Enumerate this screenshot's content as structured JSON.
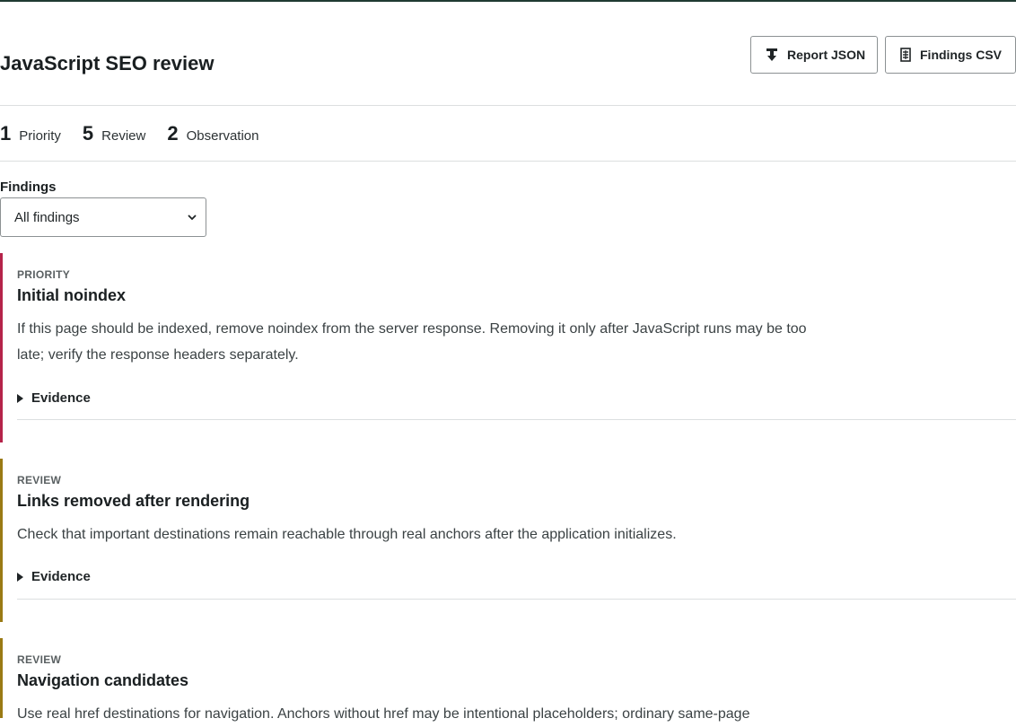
{
  "header": {
    "title": "JavaScript SEO review",
    "buttons": {
      "report_json": "Report JSON",
      "findings_csv": "Findings CSV"
    }
  },
  "summary": [
    {
      "count": "1",
      "label": "Priority"
    },
    {
      "count": "5",
      "label": "Review"
    },
    {
      "count": "2",
      "label": "Observation"
    }
  ],
  "filter": {
    "label": "Findings",
    "selected": "All findings"
  },
  "findings": [
    {
      "severity": "PRIORITY",
      "title": "Initial noindex",
      "body": "If this page should be indexed, remove noindex from the server response. Removing it only after JavaScript runs may be too late; verify the response headers separately.",
      "evidence_label": "Evidence"
    },
    {
      "severity": "REVIEW",
      "title": "Links removed after rendering",
      "body": "Check that important destinations remain reachable through real anchors after the application initializes.",
      "evidence_label": "Evidence"
    },
    {
      "severity": "REVIEW",
      "title": "Navigation candidates",
      "body": "Use real href destinations for navigation. Anchors without href may be intentional placeholders; ordinary same-page"
    }
  ],
  "colors": {
    "priority_accent": "#b5234a",
    "review_accent": "#9a7a14",
    "top_rule": "#1f3a32"
  },
  "icons": {
    "report_json": "download-icon",
    "findings_csv": "spreadsheet-icon",
    "select": "chevron-down-icon",
    "evidence": "triangle-right-icon"
  }
}
